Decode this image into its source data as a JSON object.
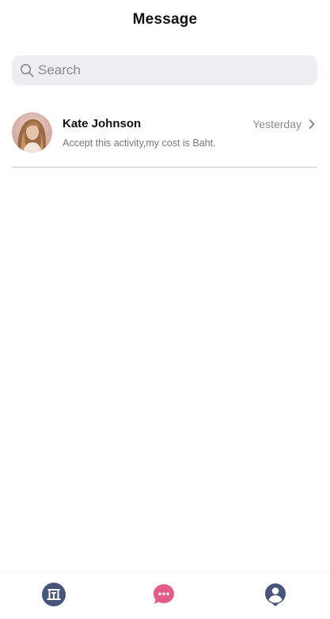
{
  "header": {
    "title": "Message"
  },
  "search": {
    "placeholder": "Search"
  },
  "messages": [
    {
      "name": "Kate Johnson",
      "time": "Yesterday",
      "preview": "Accept this activity,my cost is Baht."
    }
  ],
  "tabbar": {
    "tabs": [
      {
        "icon": "home-building-icon",
        "active": false
      },
      {
        "icon": "chat-bubble-icon",
        "active": true
      },
      {
        "icon": "profile-icon",
        "active": false
      }
    ]
  },
  "colors": {
    "accent": "#e35d86",
    "tab_inactive": "#47557a",
    "search_bg": "#eeeef0",
    "divider": "#cfcfcf"
  }
}
